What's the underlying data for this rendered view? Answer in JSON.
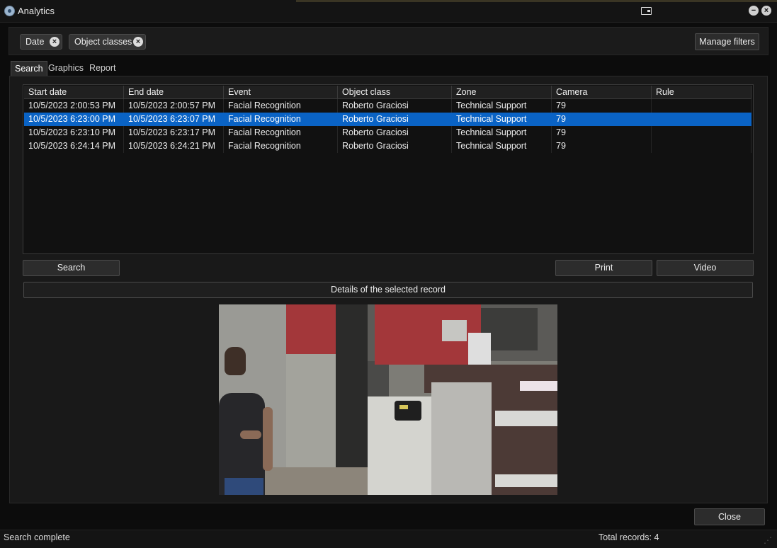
{
  "window": {
    "title": "Analytics",
    "icons": {
      "app": "app-globe-icon",
      "dock": "dock-window-icon",
      "minimize": "minimize-icon",
      "close": "close-icon"
    }
  },
  "filters": {
    "chips": [
      {
        "label": "Date",
        "remove_icon": "remove-chip-icon"
      },
      {
        "label": "Object classes",
        "remove_icon": "remove-chip-icon"
      }
    ],
    "manage_label": "Manage filters"
  },
  "tabs": [
    {
      "label": "Search",
      "active": true
    },
    {
      "label": "Graphics",
      "active": false
    },
    {
      "label": "Report",
      "active": false
    }
  ],
  "table": {
    "columns": [
      "Start date",
      "End date",
      "Event",
      "Object class",
      "Zone",
      "Camera",
      "Rule"
    ],
    "rows": [
      [
        "10/5/2023 2:00:53 PM",
        "10/5/2023 2:00:57 PM",
        "Facial Recognition",
        "Roberto Graciosi",
        "Technical Support",
        "79",
        ""
      ],
      [
        "10/5/2023 6:23:00 PM",
        "10/5/2023 6:23:07 PM",
        "Facial Recognition",
        "Roberto Graciosi",
        "Technical Support",
        "79",
        ""
      ],
      [
        "10/5/2023 6:23:10 PM",
        "10/5/2023 6:23:17 PM",
        "Facial Recognition",
        "Roberto Graciosi",
        "Technical Support",
        "79",
        ""
      ],
      [
        "10/5/2023 6:24:14 PM",
        "10/5/2023 6:24:21 PM",
        "Facial Recognition",
        "Roberto Graciosi",
        "Technical Support",
        "79",
        ""
      ]
    ],
    "selected_index": 1,
    "colors": {
      "selection": "#0a63c5"
    }
  },
  "actions": {
    "search_label": "Search",
    "print_label": "Print",
    "video_label": "Video"
  },
  "details": {
    "label": "Details of the selected record"
  },
  "footer": {
    "close_label": "Close",
    "status_text": "Search complete",
    "total_records": "Total records: 4"
  }
}
